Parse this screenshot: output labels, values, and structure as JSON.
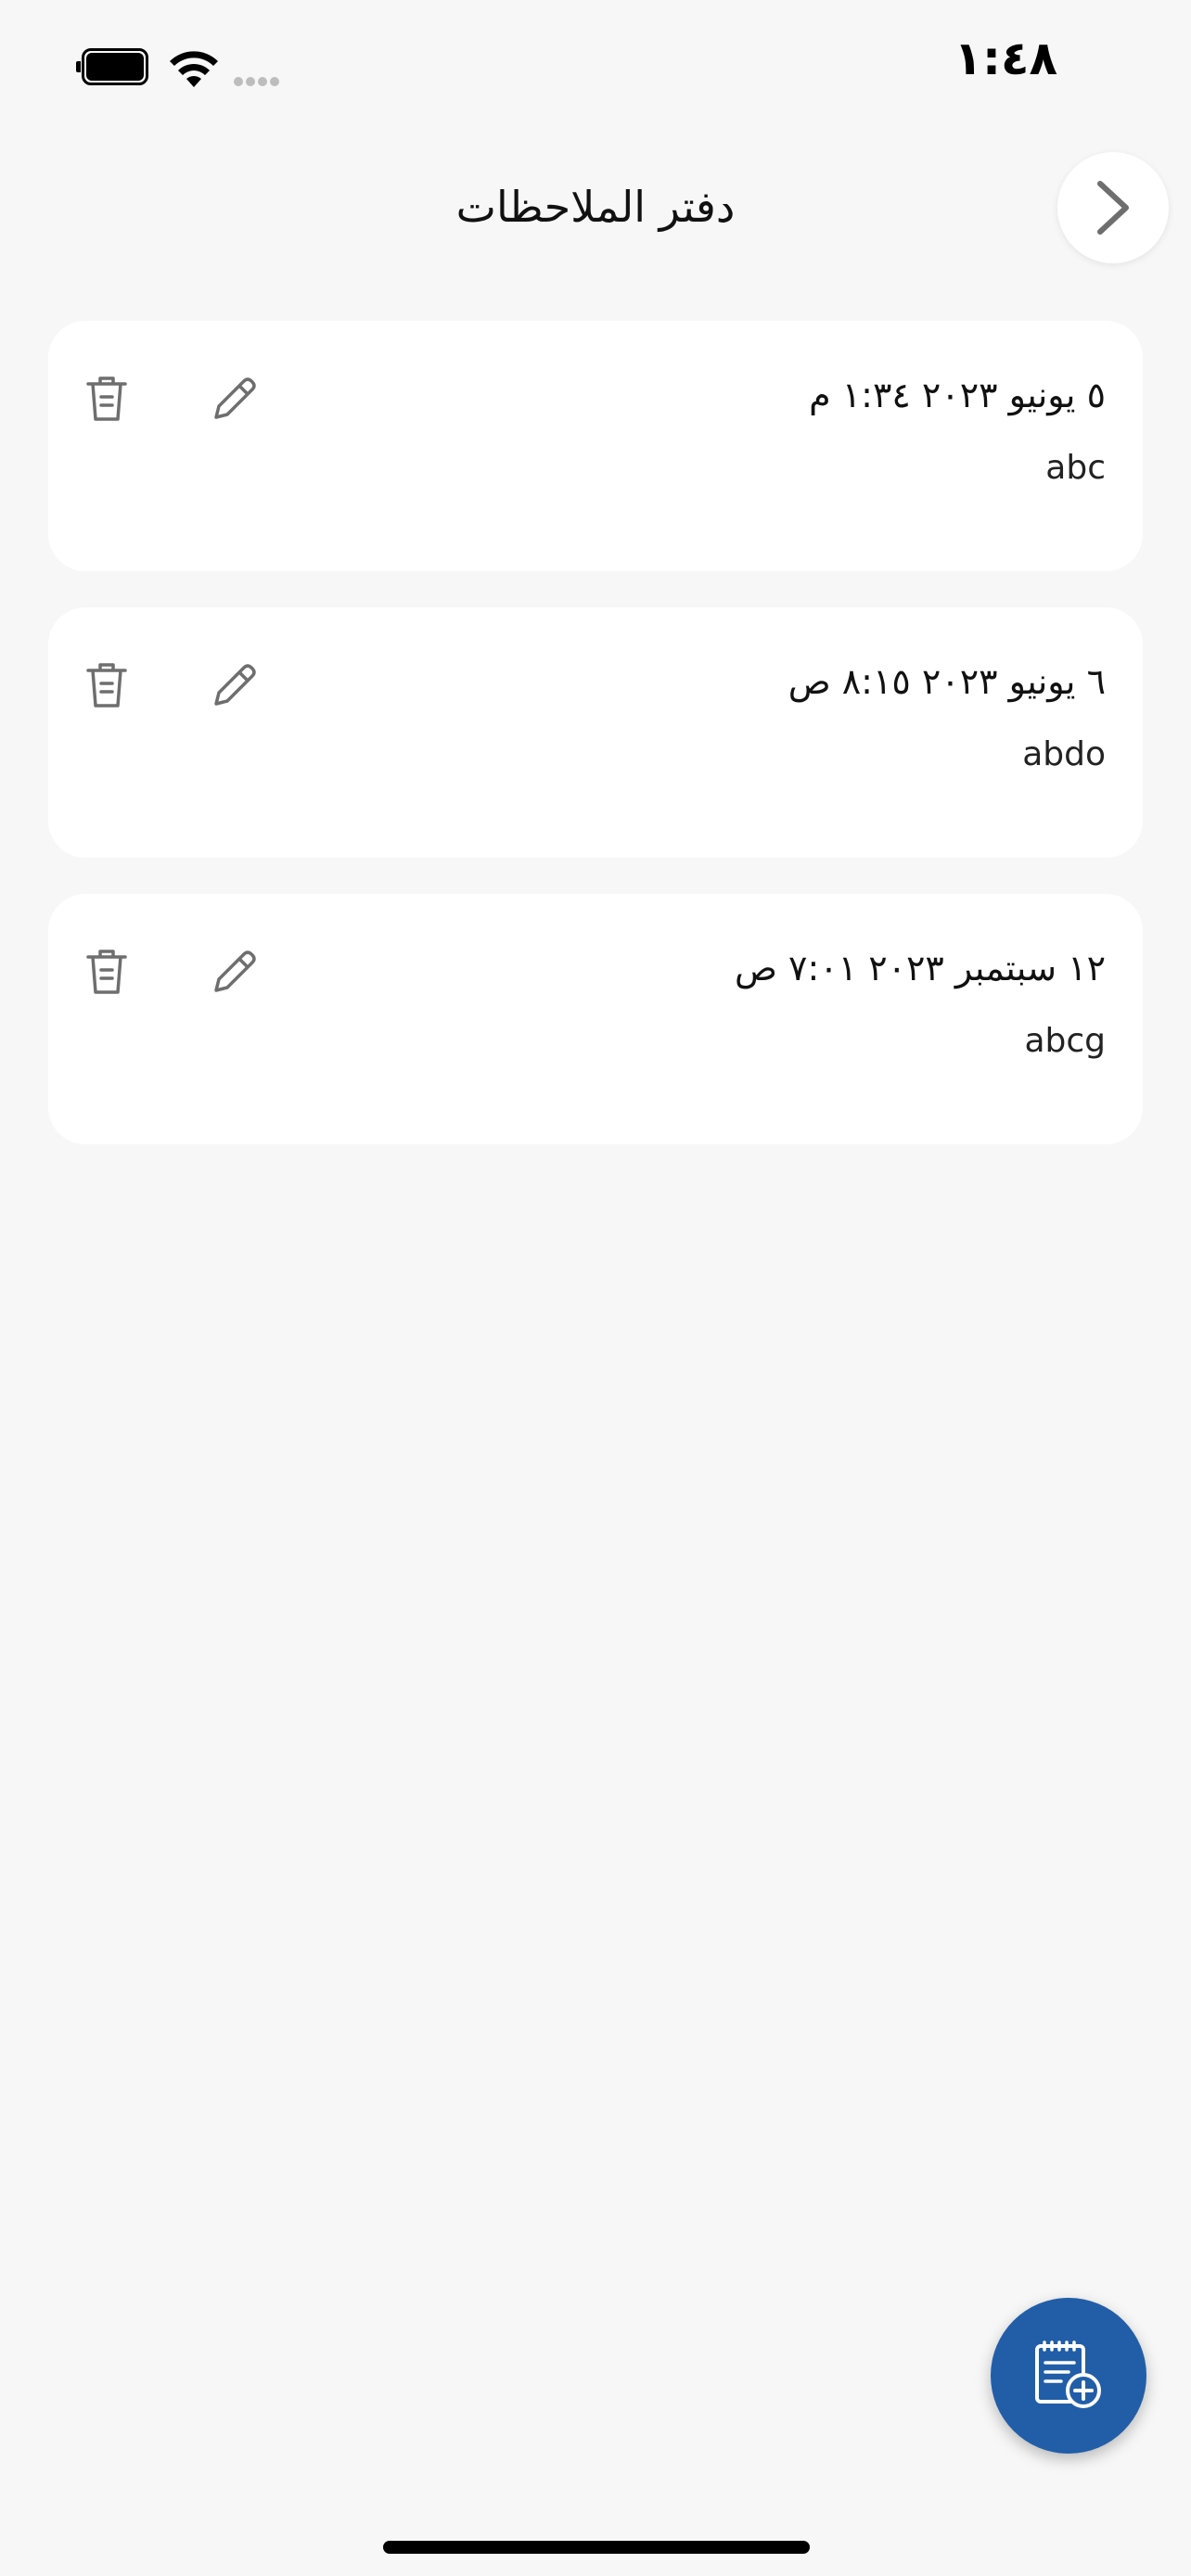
{
  "status_bar": {
    "time": "١:٤٨",
    "icons": [
      "battery-icon",
      "wifi-icon",
      "signal-icon"
    ]
  },
  "header": {
    "title": "دفتر الملاحظات",
    "back_icon": "chevron-right-icon"
  },
  "notes": [
    {
      "date": "٥ يونيو ٢٠٢٣ ١:٣٤ م",
      "text": "abc"
    },
    {
      "date": "٦ يونيو ٢٠٢٣ ٨:١٥ ص",
      "text": "abdo"
    },
    {
      "date": "١٢ سبتمبر ٢٠٢٣ ٧:٠١ ص",
      "text": "abcg"
    }
  ],
  "note_actions": {
    "edit_icon": "pencil-icon",
    "delete_icon": "trash-icon"
  },
  "fab": {
    "icon": "add-note-icon"
  },
  "colors": {
    "background": "#f7f7f7",
    "card": "#ffffff",
    "accent": "#225ea8",
    "icon_gray": "#6e6e6e"
  }
}
